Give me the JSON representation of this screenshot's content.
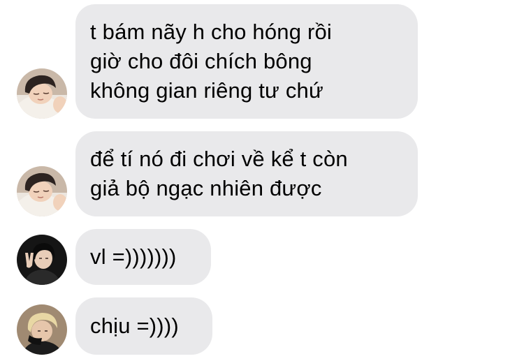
{
  "messages": [
    {
      "sender_avatar": "avatar-sleeping-boy",
      "lines": [
        "t bám nãy h cho hóng rồi",
        "giờ cho đôi chích bông",
        "không gian riêng tư chứ"
      ]
    },
    {
      "sender_avatar": "avatar-sleeping-boy",
      "lines": [
        "để tí nó đi chơi về kể t còn",
        "giả bộ ngạc nhiên được"
      ]
    },
    {
      "sender_avatar": "avatar-peace-sign-boy",
      "lines": [
        "vl =)))))))"
      ]
    },
    {
      "sender_avatar": "avatar-blond-boy",
      "lines": [
        "chịu =))))"
      ]
    }
  ],
  "colors": {
    "bubble_bg": "#e9e9eb",
    "text": "#000000",
    "background": "#ffffff"
  }
}
